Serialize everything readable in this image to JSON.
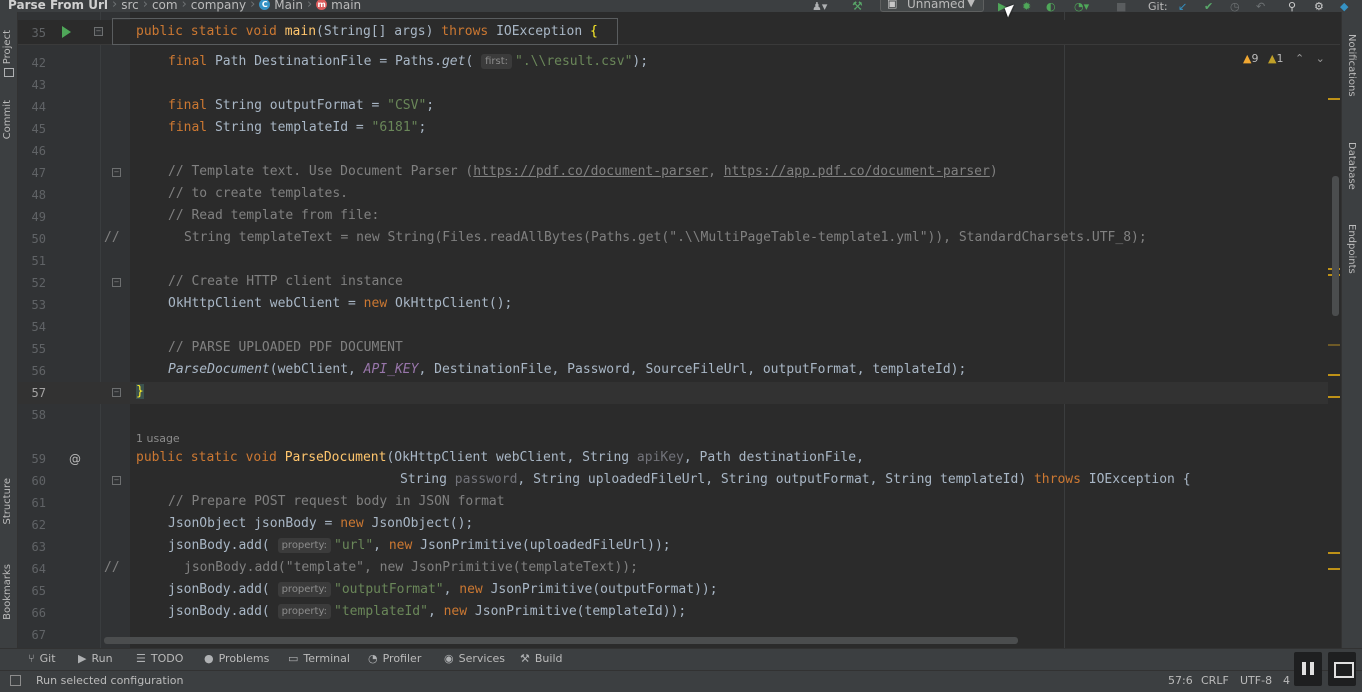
{
  "breadcrumbs": [
    {
      "label": "Parse From Url",
      "icon": ""
    },
    {
      "label": "src",
      "icon": ""
    },
    {
      "label": "com",
      "icon": ""
    },
    {
      "label": "company",
      "icon": ""
    },
    {
      "label": "Main",
      "icon": "class-icon"
    },
    {
      "label": "main",
      "icon": "method-icon"
    }
  ],
  "toolbar": {
    "run_config": "Unnamed",
    "git_label": "Git:"
  },
  "left_tabs": [
    "Project",
    "Commit",
    "Structure",
    "Bookmarks"
  ],
  "right_tabs": [
    "Notifications",
    "Database",
    "Endpoints"
  ],
  "sticky": {
    "line": "35",
    "text": "public static void main(String[] args) throws IOException {"
  },
  "inspections": {
    "warnings": "9",
    "weak_warnings": "1"
  },
  "usage_hint": "1 usage",
  "lines": [
    {
      "n": "42",
      "code": "final Path DestinationFile = Paths.get( first: \".\\\\result.csv\");"
    },
    {
      "n": "43",
      "code": ""
    },
    {
      "n": "44",
      "code": "final String outputFormat = \"CSV\";"
    },
    {
      "n": "45",
      "code": "final String templateId = \"6181\";"
    },
    {
      "n": "46",
      "code": ""
    },
    {
      "n": "47",
      "code": "// Template text. Use Document Parser (https://pdf.co/document-parser, https://app.pdf.co/document-parser)"
    },
    {
      "n": "48",
      "code": "// to create templates."
    },
    {
      "n": "49",
      "code": "// Read template from file:"
    },
    {
      "n": "50",
      "code": "// String templateText = new String(Files.readAllBytes(Paths.get(\".\\\\MultiPageTable-template1.yml\")), StandardCharsets.UTF_8);"
    },
    {
      "n": "51",
      "code": ""
    },
    {
      "n": "52",
      "code": "// Create HTTP client instance"
    },
    {
      "n": "53",
      "code": "OkHttpClient webClient = new OkHttpClient();"
    },
    {
      "n": "54",
      "code": ""
    },
    {
      "n": "55",
      "code": "// PARSE UPLOADED PDF DOCUMENT"
    },
    {
      "n": "56",
      "code": "ParseDocument(webClient, API_KEY, DestinationFile, Password, SourceFileUrl, outputFormat, templateId);"
    },
    {
      "n": "57",
      "code": "}"
    },
    {
      "n": "58",
      "code": ""
    },
    {
      "n": "59",
      "code": "public static void ParseDocument(OkHttpClient webClient, String apiKey, Path destinationFile,"
    },
    {
      "n": "60",
      "code": "String password, String uploadedFileUrl, String outputFormat, String templateId) throws IOException {"
    },
    {
      "n": "61",
      "code": "// Prepare POST request body in JSON format"
    },
    {
      "n": "62",
      "code": "JsonObject jsonBody = new JsonObject();"
    },
    {
      "n": "63",
      "code": "jsonBody.add( property: \"url\", new JsonPrimitive(uploadedFileUrl));"
    },
    {
      "n": "64",
      "code": "// jsonBody.add(\"template\", new JsonPrimitive(templateText));"
    },
    {
      "n": "65",
      "code": "jsonBody.add( property: \"outputFormat\", new JsonPrimitive(outputFormat));"
    },
    {
      "n": "66",
      "code": "jsonBody.add( property: \"templateId\", new JsonPrimitive(templateId));"
    },
    {
      "n": "67",
      "code": ""
    }
  ],
  "tool_tabs": [
    "Git",
    "Run",
    "TODO",
    "Problems",
    "Terminal",
    "Profiler",
    "Services",
    "Build"
  ],
  "status": {
    "message": "Run selected configuration",
    "position": "57:6",
    "line_sep": "CRLF",
    "encoding": "UTF-8",
    "indent": "4"
  },
  "colors": {
    "keyword": "#cc7832",
    "function": "#ffc66d",
    "string": "#6a8759",
    "comment": "#808080",
    "warning": "#be9117"
  }
}
